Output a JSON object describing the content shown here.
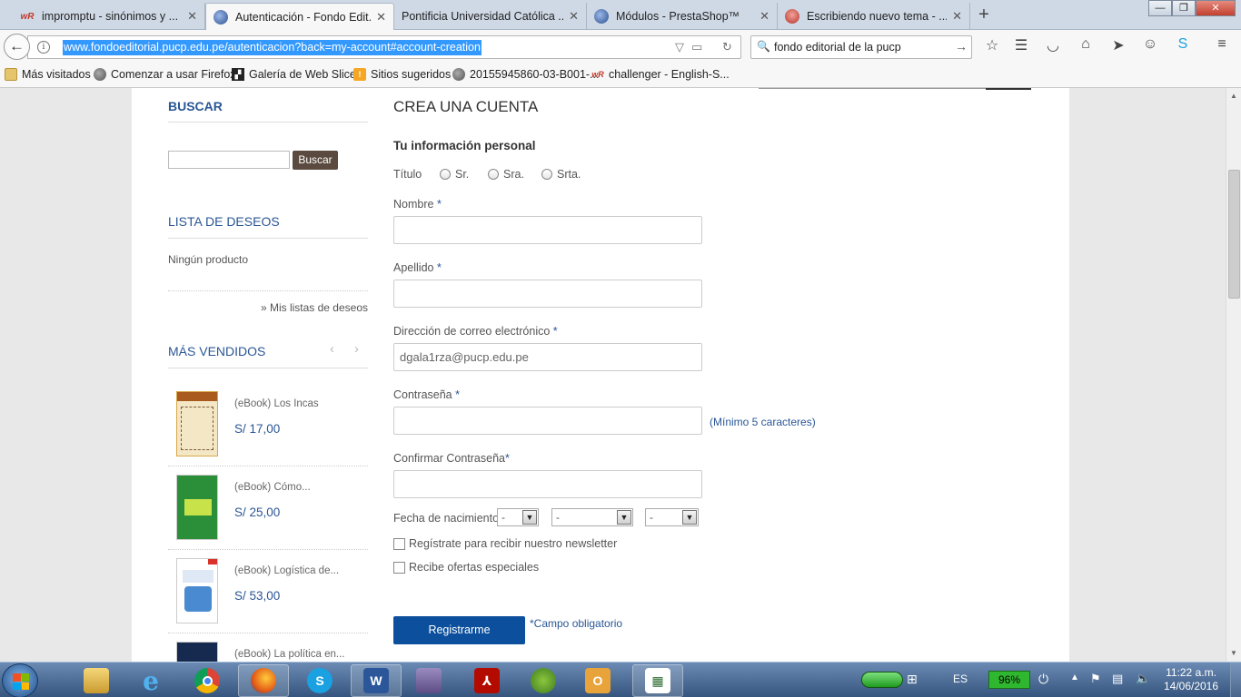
{
  "browser": {
    "tabs": [
      {
        "title": "impromptu - sinónimos y ...",
        "favicon": "wr"
      },
      {
        "title": "Autenticación - Fondo Edit...",
        "favicon": "circle",
        "active": true
      },
      {
        "title": "Pontificia Universidad Católica ...",
        "favicon": "none"
      },
      {
        "title": "Módulos - PrestaShop™",
        "favicon": "circle"
      },
      {
        "title": "Escribiendo nuevo tema - ...",
        "favicon": "red"
      }
    ],
    "new_tab": "+",
    "url": "www.fondoeditorial.pucp.edu.pe/autenticacion?back=my-account#account-creation",
    "search_query": "fondo editorial de la pucp",
    "bookmarks": [
      {
        "label": "Más visitados",
        "icon": "folder"
      },
      {
        "label": "Comenzar a usar Firefox",
        "icon": "globe"
      },
      {
        "label": "Galería de Web Slice",
        "icon": "slice"
      },
      {
        "label": "Sitios sugeridos",
        "icon": "suggest"
      },
      {
        "label": "20155945860-03-B001-...",
        "icon": "globe"
      },
      {
        "label": "challenger - English-S...",
        "icon": "wr"
      }
    ]
  },
  "sidebar": {
    "search_title": "BUSCAR",
    "search_button": "Buscar",
    "wishlist_title": "LISTA DE DESEOS",
    "wishlist_empty": "Ningún producto",
    "wishlist_link": "» Mis listas de deseos",
    "bestsellers_title": "MÁS VENDIDOS",
    "products": [
      {
        "name": "(eBook) Los Incas",
        "price": "S/ 17,00"
      },
      {
        "name": "(eBook) Cómo...",
        "price": "S/ 25,00"
      },
      {
        "name": "(eBook) Logística de...",
        "price": "S/ 53,00"
      },
      {
        "name": "(eBook) La política en...",
        "price": ""
      }
    ]
  },
  "form": {
    "heading": "CREA UNA CUENTA",
    "subheading": "Tu información personal",
    "title_label": "Título",
    "title_options": [
      "Sr.",
      "Sra.",
      "Srta."
    ],
    "first_name_label": "Nombre",
    "last_name_label": "Apellido",
    "email_label": "Dirección de correo electrónico",
    "email_value": "dgala1rza@pucp.edu.pe",
    "password_label": "Contraseña",
    "password_hint": "(Mínimo 5 caracteres)",
    "confirm_label": "Confirmar Contraseña",
    "birthdate_label": "Fecha de nacimiento",
    "birthdate_day": "-",
    "birthdate_month": "-",
    "birthdate_year": "-",
    "newsletter_label": "Regístrate para recibir nuestro newsletter",
    "offers_label": "Recibe ofertas especiales",
    "register_button": "Registrarme",
    "required_note": "*Campo obligatorio",
    "asterisk": "*"
  },
  "taskbar": {
    "language": "ES",
    "battery": "96%",
    "time": "11:22 a.m.",
    "date": "14/06/2016"
  }
}
